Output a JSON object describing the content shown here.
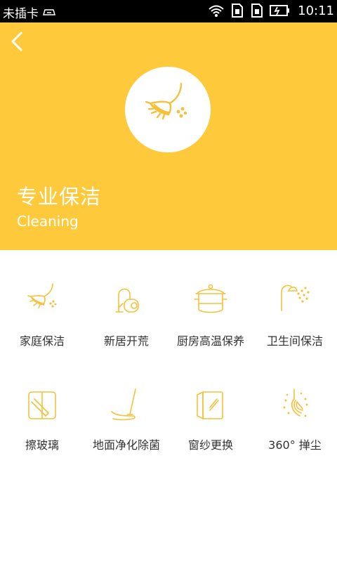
{
  "status_bar": {
    "carrier": "未插卡",
    "time": "10:11"
  },
  "colors": {
    "accent": "#fec93a",
    "icon_stroke": "#f5c13a",
    "text": "#333333"
  },
  "hero": {
    "title": "专业保洁",
    "subtitle": "Cleaning",
    "icon": "broom-icon"
  },
  "services": [
    {
      "label": "家庭保洁",
      "icon": "broom-icon"
    },
    {
      "label": "新居开荒",
      "icon": "vacuum-icon"
    },
    {
      "label": "厨房高温保养",
      "icon": "pot-icon"
    },
    {
      "label": "卫生间保洁",
      "icon": "shower-icon"
    },
    {
      "label": "擦玻璃",
      "icon": "window-wiper-icon"
    },
    {
      "label": "地面净化除菌",
      "icon": "mop-icon"
    },
    {
      "label": "窗纱更换",
      "icon": "window-screen-icon"
    },
    {
      "label": "360° 掸尘",
      "icon": "duster-icon"
    }
  ]
}
